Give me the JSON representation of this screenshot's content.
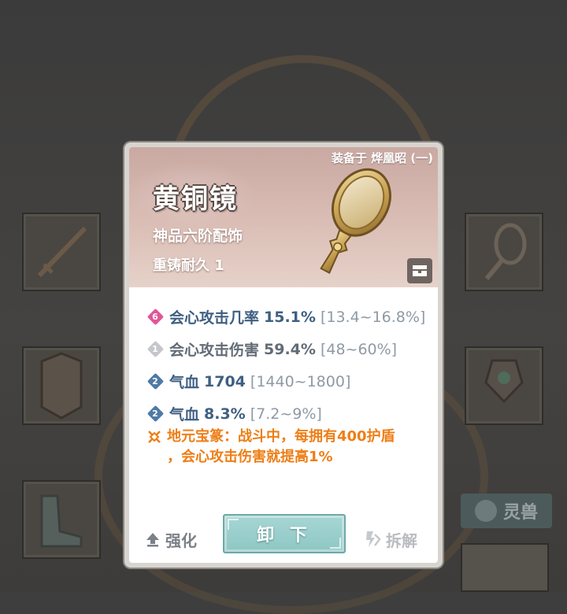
{
  "background": {
    "side_tab_label": "灵兽"
  },
  "dialog": {
    "equipped_label": "装备于 烨凰昭 (一)",
    "item_name": "黄铜镜",
    "item_grade": "神品六阶配饰",
    "durability": "重铸耐久 1",
    "attributes": [
      {
        "badge": "6",
        "badge_color": "#e0569a",
        "name": "会心攻击几率",
        "value": "15.1%",
        "range": "[13.4~16.8%]"
      },
      {
        "badge": "1",
        "badge_color": "#c4c7cb",
        "name": "会心攻击伤害",
        "value": "59.4%",
        "range": "[48~60%]"
      },
      {
        "badge": "2",
        "badge_color": "#4f7aa6",
        "name": "气血",
        "value": "1704",
        "range": "[1440~1800]"
      },
      {
        "badge": "2",
        "badge_color": "#4f7aa6",
        "name": "气血",
        "value": "8.3%",
        "range": "[7.2~9%]"
      }
    ],
    "special": {
      "line1": "地元宝篆：战斗中，每拥有400护盾",
      "line2": "，会心攻击伤害就提高1%",
      "color": "#ee7e16"
    },
    "buttons": {
      "upgrade": "强化",
      "unequip": "卸 下",
      "dismantle": "拆解"
    }
  }
}
